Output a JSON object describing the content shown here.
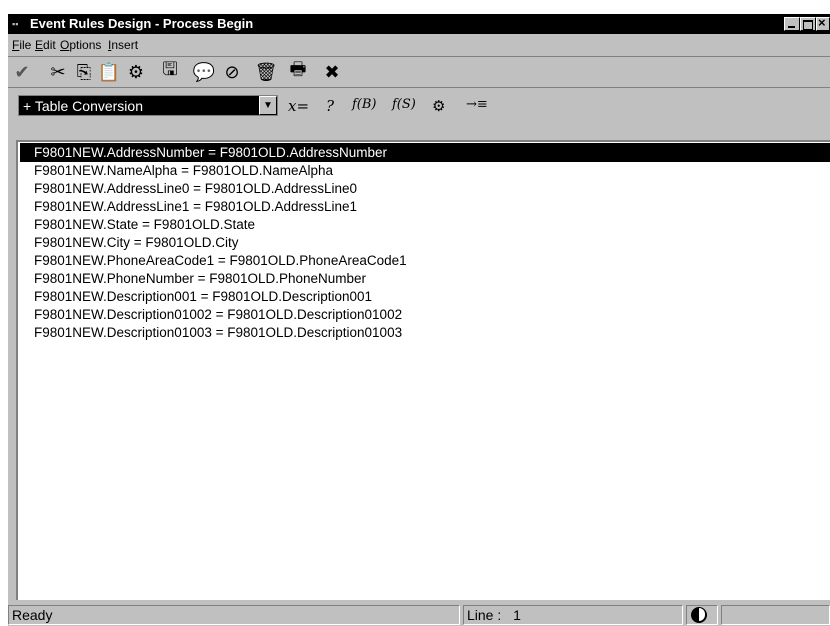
{
  "window": {
    "title": "Event Rules Design - Process Begin",
    "app_icon": "event-rules-icon"
  },
  "title_buttons": {
    "minimize": "_",
    "maximize": "□",
    "close": "×"
  },
  "menus": [
    {
      "label": "File",
      "mnemonic": "F",
      "rest": "ile"
    },
    {
      "label": "Edit",
      "mnemonic": "E",
      "rest": "dit"
    },
    {
      "label": "Options",
      "mnemonic": "O",
      "rest": "ptions"
    },
    {
      "label": "Insert",
      "mnemonic": "I",
      "rest": "nsert"
    }
  ],
  "toolbar": {
    "icons": [
      "checkmark-icon",
      "scissors-icon",
      "copy-icon",
      "paste-icon",
      "clipboard-icon",
      "save-icon",
      "comment-icon",
      "cancel-icon",
      "trash-icon",
      "print-icon",
      "close-x-icon"
    ],
    "glyphs": [
      "✔",
      "✂",
      "⎘",
      "📋",
      "⚙",
      "🖫",
      "💬",
      "⊘",
      "🗑",
      "🖶",
      "✖"
    ]
  },
  "combo": {
    "value": "+ Table Conversion"
  },
  "assist_tools": {
    "assign": "x=",
    "help": "?",
    "business_function": "f(B)",
    "system_function": "f(S)",
    "variables": "⚙",
    "insert_line": "→≡"
  },
  "lines": [
    "F9801NEW.AddressNumber = F9801OLD.AddressNumber",
    "F9801NEW.NameAlpha = F9801OLD.NameAlpha",
    "F9801NEW.AddressLine0 = F9801OLD.AddressLine0",
    "F9801NEW.AddressLine1 = F9801OLD.AddressLine1",
    "F9801NEW.State = F9801OLD.State",
    "F9801NEW.City = F9801OLD.City",
    "F9801NEW.PhoneAreaCode1 = F9801OLD.PhoneAreaCode1",
    "F9801NEW.PhoneNumber = F9801OLD.PhoneNumber",
    "F9801NEW.Description001 = F9801OLD.Description001",
    "F9801NEW.Description01002 = F9801OLD.Description01002",
    "F9801NEW.Description01003 = F9801OLD.Description01003"
  ],
  "selected_line": 0,
  "status": {
    "text": "Ready",
    "line_label": "Line :",
    "line_value": "1",
    "globe_icon": "globe-icon"
  }
}
